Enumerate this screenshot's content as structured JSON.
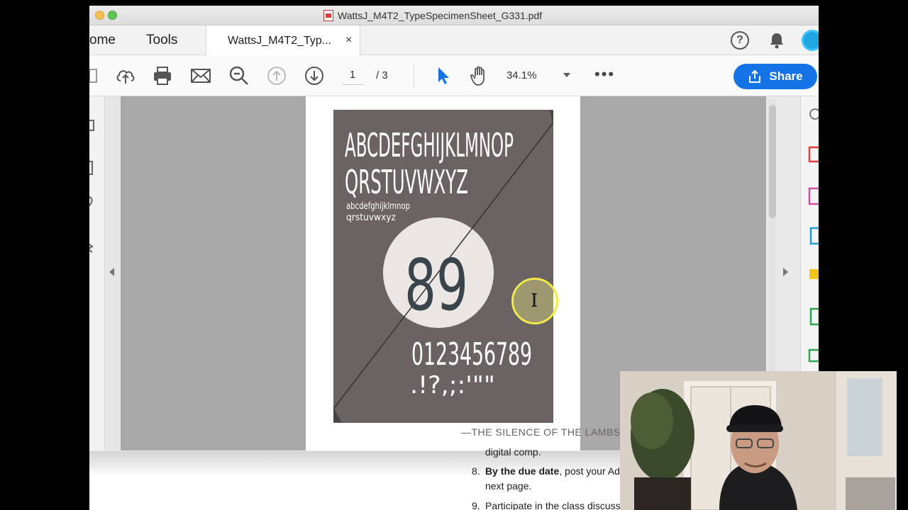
{
  "window": {
    "title": "WattsJ_M4T2_TypeSpecimenSheet_G331.pdf"
  },
  "tabs": {
    "home": "ome",
    "tools": "Tools",
    "document": "WattsJ_M4T2_Typ...",
    "close": "×"
  },
  "toolbar": {
    "page_current": "1",
    "page_total": "/  3",
    "zoom": "34.1%",
    "more": "•••",
    "share_label": "Share"
  },
  "poster": {
    "line1": "ABCDEFGHIJKLMNOP",
    "line2": "QRSTUVWXYZ",
    "lower1": "abcdefghijklmnop",
    "lower2": "qrstuvwxyz",
    "big": "89",
    "digits": "0123456789",
    "punct": ".!?,;:'\"\"",
    "credit": "—THE SILENCE OF THE LAMBS"
  },
  "instructions": {
    "partial_line": "digital comp.",
    "item8_num": "8.",
    "item8_bold": "By the due date",
    "item8_rest": ", post your Ado",
    "item8_line2": "next page.",
    "item9_num": "9.",
    "item9_text": "Participate in the class discuss"
  },
  "colors": {
    "poster_bg": "#6b6263",
    "share_blue": "#1473e6",
    "canvas_gray": "#a8a8a8",
    "cursor_yellow": "#f2e84a"
  }
}
